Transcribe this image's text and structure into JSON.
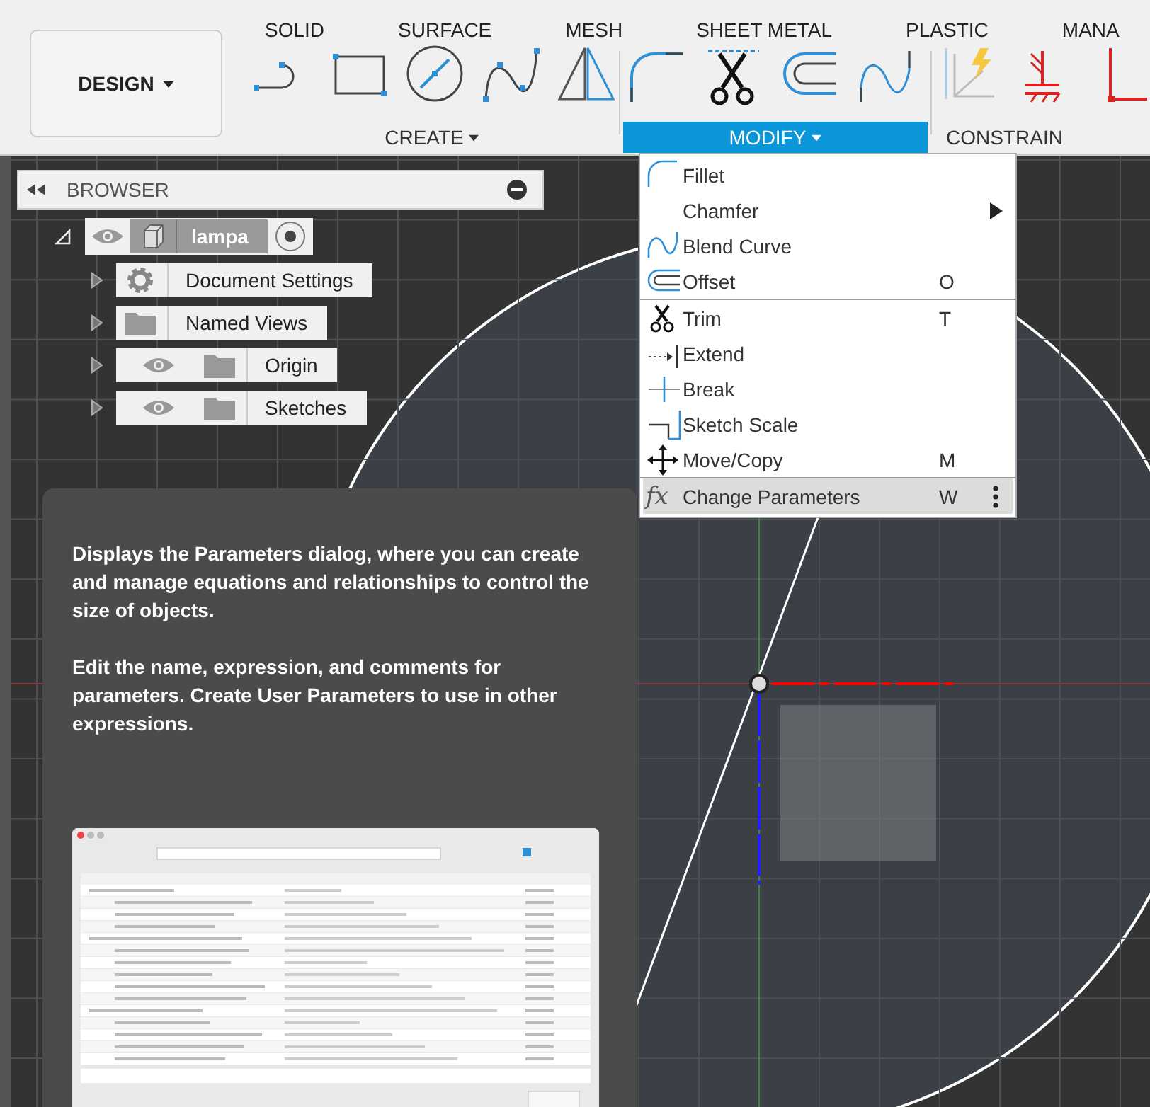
{
  "workspace_button": {
    "label": "DESIGN"
  },
  "tabs": [
    {
      "label": "SOLID"
    },
    {
      "label": "SURFACE"
    },
    {
      "label": "MESH"
    },
    {
      "label": "SHEET METAL"
    },
    {
      "label": "PLASTIC"
    },
    {
      "label": "MANA"
    }
  ],
  "tool_groups": [
    {
      "label": "CREATE",
      "selected": false,
      "tools": [
        {
          "kind": "arc-line"
        },
        {
          "kind": "rectangle"
        },
        {
          "kind": "circle"
        },
        {
          "kind": "spline"
        },
        {
          "kind": "mirror"
        }
      ]
    },
    {
      "label": "MODIFY",
      "selected": true,
      "tools": [
        {
          "kind": "fillet"
        },
        {
          "kind": "trim"
        },
        {
          "kind": "offset"
        },
        {
          "kind": "blend"
        }
      ]
    },
    {
      "label": "CONSTRAIN",
      "selected": false,
      "tools": [
        {
          "kind": "coincident"
        },
        {
          "kind": "fix"
        },
        {
          "kind": "perpendicular"
        }
      ]
    }
  ],
  "browser": {
    "title": "BROWSER",
    "root": {
      "label": "lampa",
      "expanded": true,
      "children": [
        {
          "label": "Document Settings",
          "kind": "settings",
          "eye": false
        },
        {
          "label": "Named Views",
          "kind": "folder",
          "eye": false
        },
        {
          "label": "Origin",
          "kind": "folder",
          "eye": true
        },
        {
          "label": "Sketches",
          "kind": "folder",
          "eye": true
        }
      ]
    }
  },
  "modify_menu": {
    "sections": [
      [
        {
          "label": "Fillet",
          "kind": "fillet",
          "submenu": false,
          "selected": false
        },
        {
          "label": "Chamfer",
          "kind": "none",
          "submenu": true,
          "selected": false
        },
        {
          "label": "Blend Curve",
          "kind": "blend",
          "submenu": false,
          "selected": false
        },
        {
          "label": "Offset",
          "kind": "offset",
          "shortcut": "O",
          "submenu": false,
          "selected": false
        }
      ],
      [
        {
          "label": "Trim",
          "kind": "trim",
          "shortcut": "T",
          "submenu": false,
          "selected": false
        },
        {
          "label": "Extend",
          "kind": "extend",
          "submenu": false,
          "selected": false
        },
        {
          "label": "Break",
          "kind": "break",
          "submenu": false,
          "selected": false
        },
        {
          "label": "Sketch Scale",
          "kind": "scale",
          "submenu": false,
          "selected": false
        },
        {
          "label": "Move/Copy",
          "kind": "move",
          "shortcut": "M",
          "submenu": false,
          "selected": false
        }
      ],
      [
        {
          "label": "Change Parameters",
          "kind": "glyph",
          "glyph": "fx",
          "shortcut": "W",
          "submenu": false,
          "selected": true,
          "more": true
        }
      ]
    ]
  },
  "tooltip": {
    "paragraphs": [
      "Displays the Parameters dialog, where you can create and manage equations and relationships to control the size of objects.",
      "Edit the name, expression, and comments for parameters. Create User Parameters to use in other expressions."
    ]
  }
}
